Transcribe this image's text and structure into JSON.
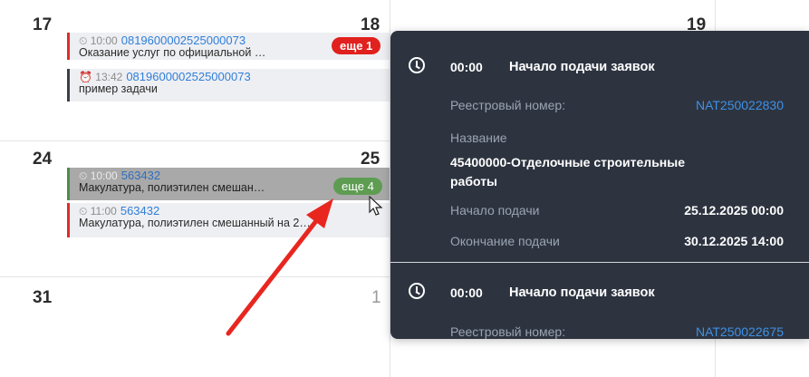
{
  "calendar": {
    "days": {
      "d17": "17",
      "d18": "18",
      "d19": "19",
      "d24": "24",
      "d25": "25",
      "d31": "31",
      "d1": "1"
    },
    "events": [
      {
        "time": "⏲ 10:00",
        "number": "0819600002525000073",
        "title": "Оказание услуг по официальной …"
      },
      {
        "time": "⏰ 13:42",
        "number": "0819600002525000073",
        "title": "пример задачи"
      },
      {
        "time": "⏲ 10:00",
        "number": "563432",
        "title": "Макулатура, полиэтилен смешан…"
      },
      {
        "time": "⏲ 11:00",
        "number": "563432",
        "title": "Макулатура, полиэтилен смешанный на 2…"
      }
    ],
    "more_badges": {
      "week1": "еще 1",
      "week2": "еще 4"
    }
  },
  "popup": {
    "entries": [
      {
        "time": "00:00",
        "title": "Начало подачи заявок",
        "registry_label": "Реестровый номер:",
        "registry_value": "NAT250022830",
        "name_label": "Название",
        "name_value_l1": "45400000-Отделочные строительные",
        "name_value_l2": "работы",
        "start_label": "Начало подачи",
        "start_value": "25.12.2025 00:00",
        "end_label": "Окончание подачи",
        "end_value": "30.12.2025 14:00"
      },
      {
        "time": "00:00",
        "title": "Начало подачи заявок",
        "registry_label": "Реестровый номер:",
        "registry_value": "NAT250022675"
      }
    ]
  },
  "colors": {
    "popup_bg": "#2d3440",
    "link": "#3f90e6",
    "accent_red": "#e0211d",
    "accent_green": "#5e9c52",
    "annotation_arrow": "#e8261f"
  }
}
